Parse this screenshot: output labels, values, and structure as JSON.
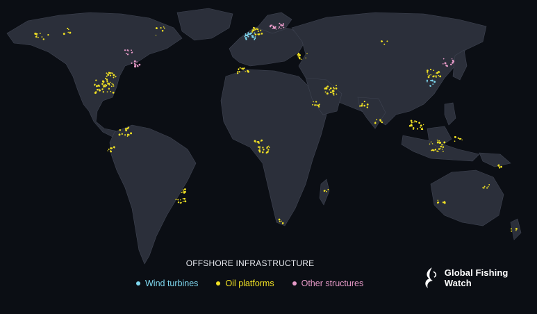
{
  "legend": {
    "title": "OFFSHORE INFRASTRUCTURE",
    "items": [
      {
        "label": "Wind turbines",
        "color": "#7fd8f0"
      },
      {
        "label": "Oil platforms",
        "color": "#f2e224"
      },
      {
        "label": "Other structures",
        "color": "#e79ac8"
      }
    ]
  },
  "brand": {
    "name": "Global Fishing Watch",
    "icon": "fish-swirl-logo-icon"
  },
  "colors": {
    "background": "#0b0e14",
    "land": "#2b2f3a",
    "borders": "#3f4452",
    "wind": "#7fd8f0",
    "oil": "#f2e224",
    "other": "#e79ac8"
  }
}
